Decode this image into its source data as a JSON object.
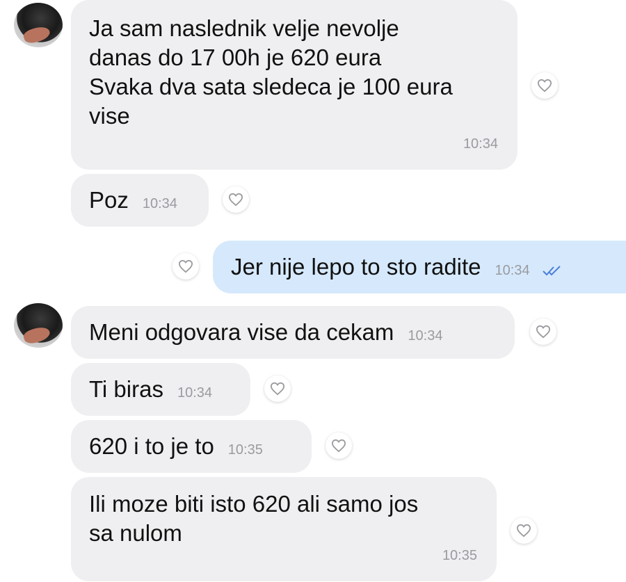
{
  "messages": [
    {
      "direction": "in",
      "text": "Ja sam naslednik velje nevolje\ndanas do 17 00h je 620 eura\nSvaka dva sata sledeca je 100 eura\nvise",
      "time": "10:34"
    },
    {
      "direction": "in",
      "text": "Poz",
      "time": "10:34"
    },
    {
      "direction": "out",
      "text": "Jer nije lepo to sto radite",
      "time": "10:34",
      "status": "read"
    },
    {
      "direction": "in",
      "text": "Meni odgovara vise da cekam",
      "time": "10:34"
    },
    {
      "direction": "in",
      "text": "Ti biras",
      "time": "10:34"
    },
    {
      "direction": "in",
      "text": "620 i to je to",
      "time": "10:35"
    },
    {
      "direction": "in",
      "text": "Ili moze biti isto 620 ali samo jos\nsa nulom",
      "time": "10:35"
    }
  ],
  "icons": {
    "reaction": "heart-outline-icon",
    "read_receipt": "double-check-icon",
    "avatar": "contact-avatar"
  },
  "colors": {
    "incoming_bubble": "#efeff1",
    "outgoing_bubble": "#d6e9fc",
    "timestamp": "#9a9aa0",
    "read_check": "#4a7fd9"
  }
}
